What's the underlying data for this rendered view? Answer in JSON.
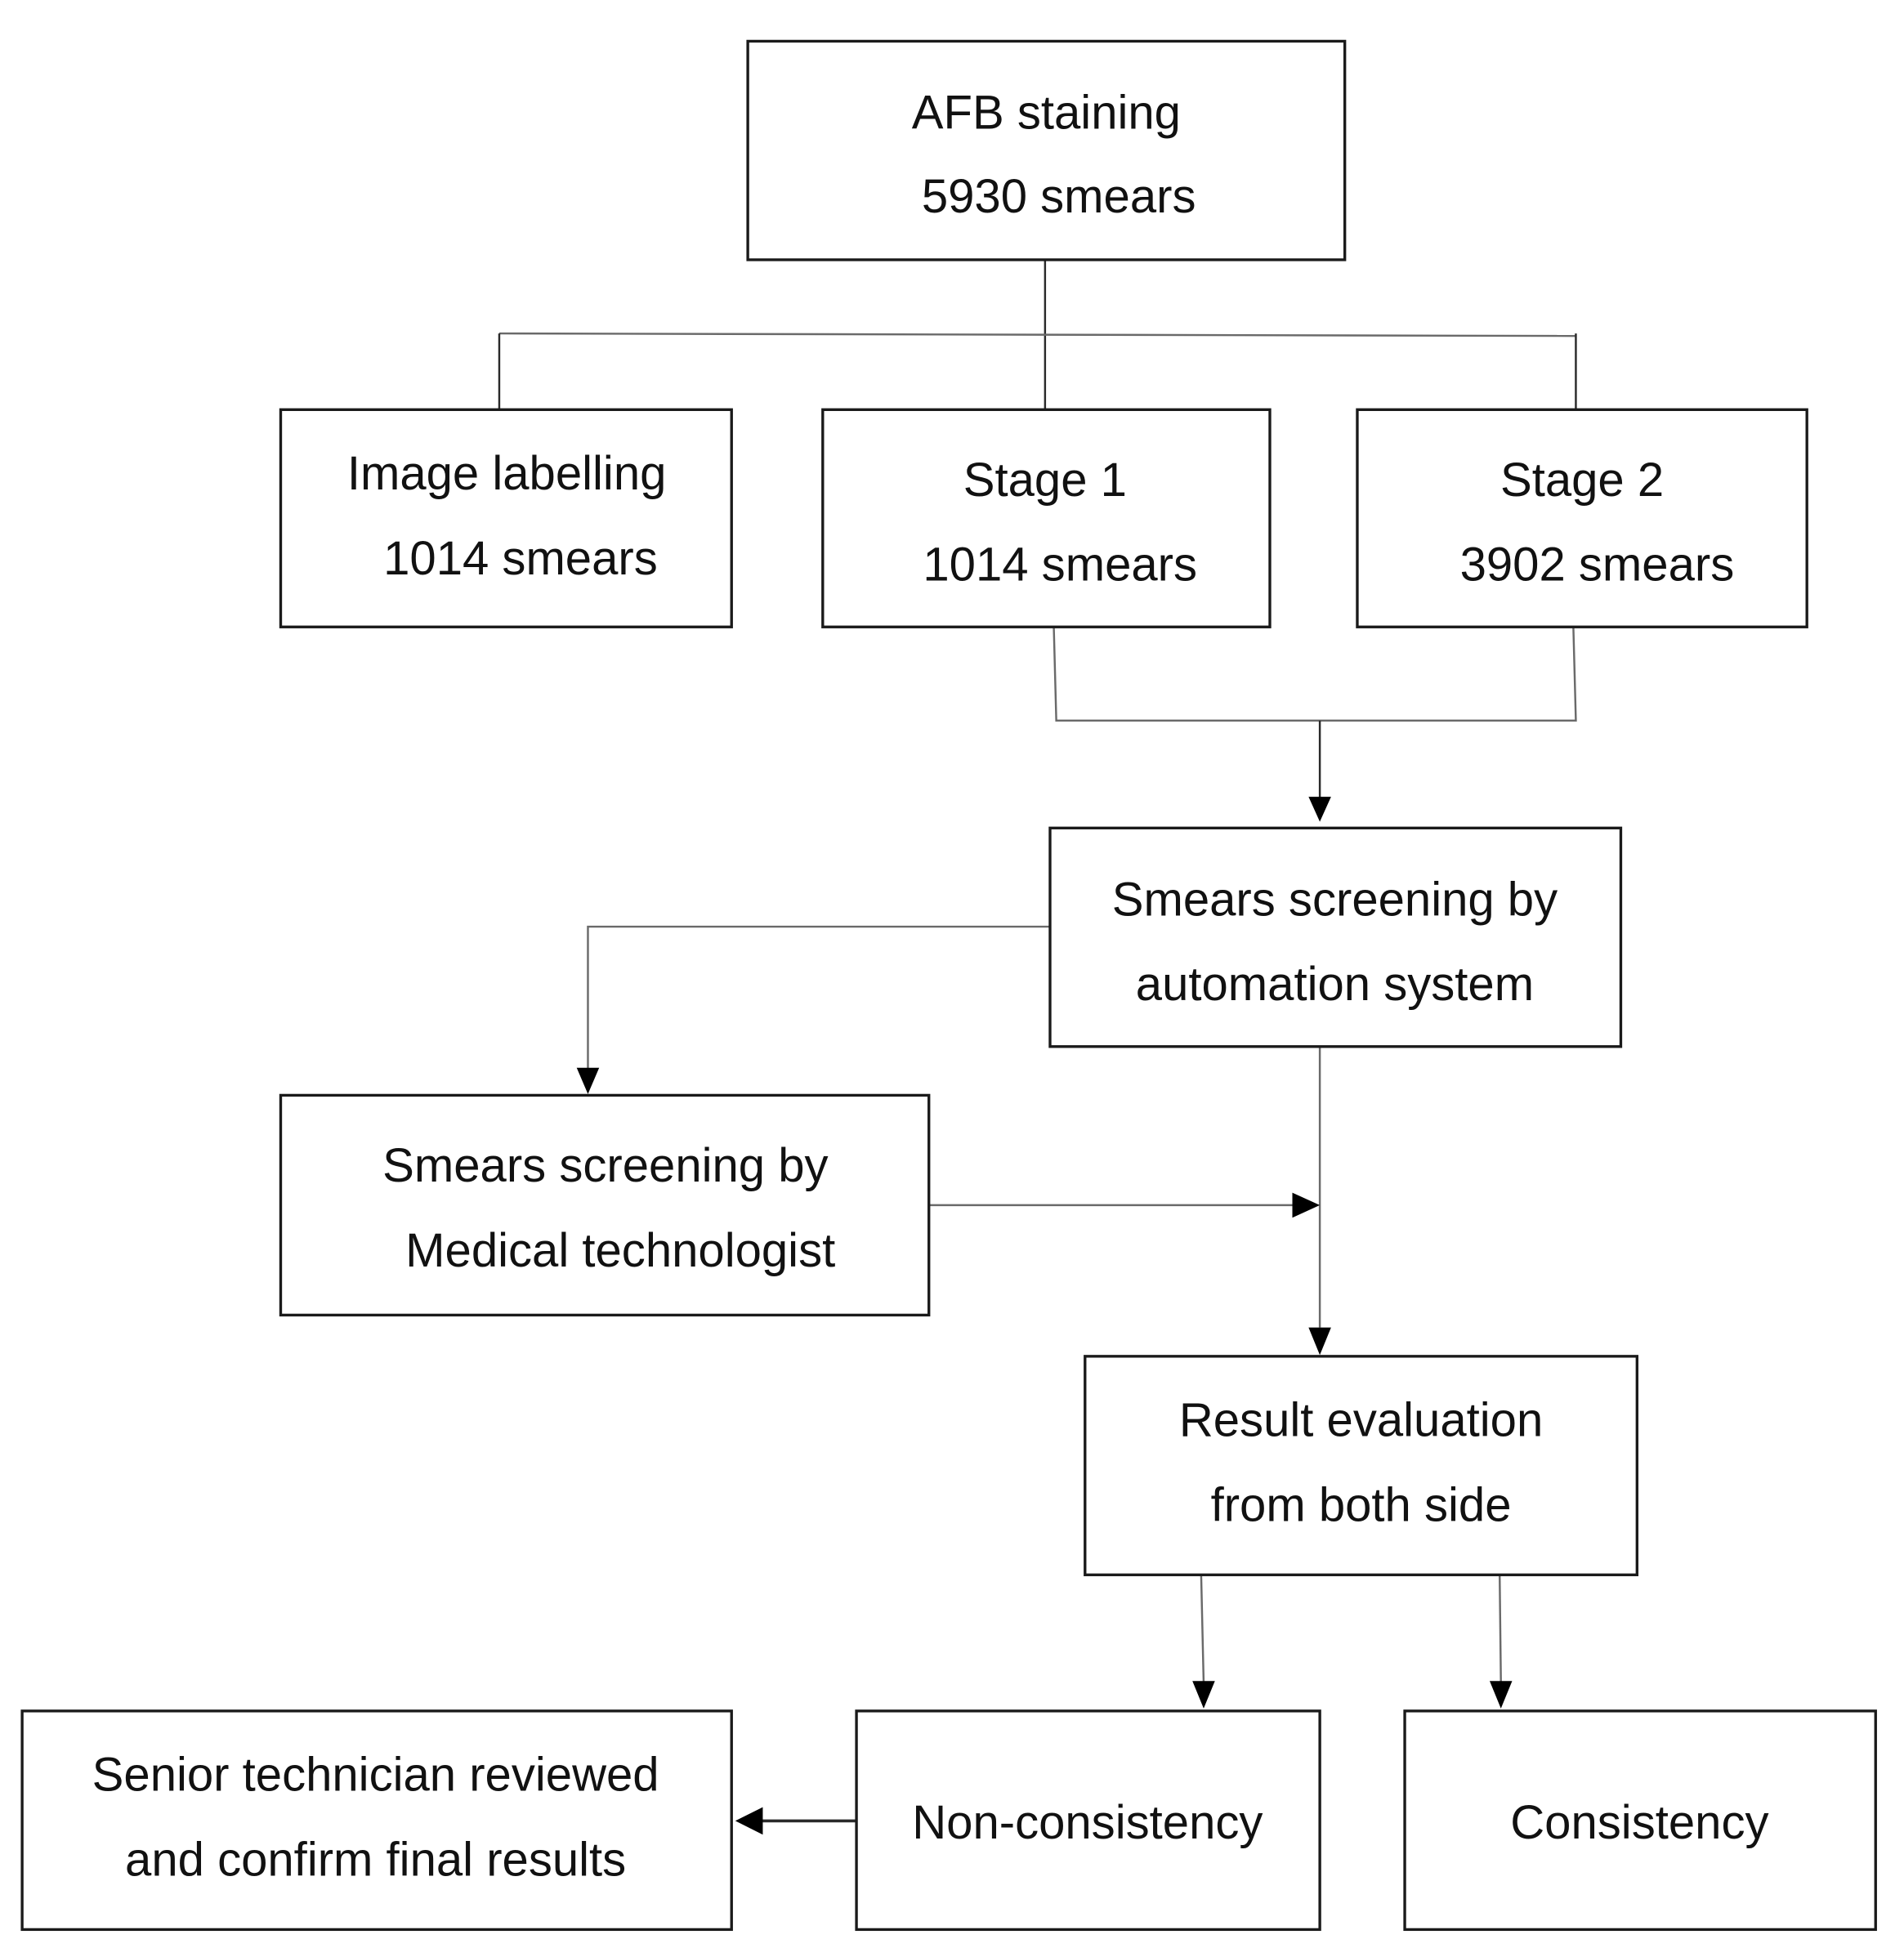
{
  "diagram": {
    "type": "flowchart",
    "nodes": {
      "afb": {
        "line1": "AFB staining",
        "line2": "5930 smears"
      },
      "labelling": {
        "line1": "Image labelling",
        "line2": "1014 smears"
      },
      "stage1": {
        "line1": "Stage 1",
        "line2": "1014 smears"
      },
      "stage2": {
        "line1": "Stage 2",
        "line2": "3902 smears"
      },
      "automation": {
        "line1": "Smears screening by",
        "line2": "automation system"
      },
      "technologist": {
        "line1": "Smears screening by",
        "line2": "Medical technologist"
      },
      "evaluation": {
        "line1": "Result evaluation",
        "line2": "from both side"
      },
      "senior": {
        "line1": "Senior technician reviewed",
        "line2": "and confirm final results"
      },
      "nonconsistency": {
        "line1": "Non-consistency"
      },
      "consistency": {
        "line1": "Consistency"
      }
    },
    "edges": [
      {
        "from": "afb",
        "to": "labelling"
      },
      {
        "from": "afb",
        "to": "stage1"
      },
      {
        "from": "afb",
        "to": "stage2"
      },
      {
        "from": "stage1",
        "to": "automation"
      },
      {
        "from": "stage2",
        "to": "automation"
      },
      {
        "from": "automation",
        "to": "technologist"
      },
      {
        "from": "automation",
        "to": "evaluation"
      },
      {
        "from": "technologist",
        "to": "evaluation"
      },
      {
        "from": "evaluation",
        "to": "nonconsistency"
      },
      {
        "from": "evaluation",
        "to": "consistency"
      },
      {
        "from": "nonconsistency",
        "to": "senior"
      }
    ]
  }
}
